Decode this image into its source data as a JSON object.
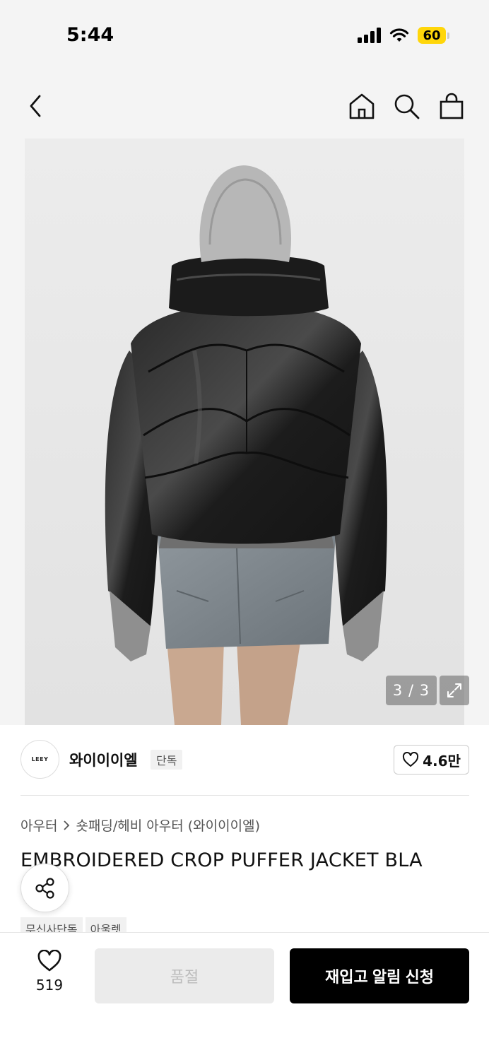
{
  "status_bar": {
    "time": "5:44",
    "battery": "60",
    "battery_color": "#ffd60a"
  },
  "nav": {
    "back_icon": "chevron-left-icon",
    "home_icon": "home-icon",
    "search_icon": "search-icon",
    "cart_icon": "shopping-bag-icon"
  },
  "gallery": {
    "counter": "3 / 3",
    "expand_icon": "expand-icon"
  },
  "brand": {
    "logo_text": "LEEY",
    "name": "와이이이엘",
    "badge": "단독",
    "likes": "4.6만"
  },
  "product": {
    "breadcrumb": [
      "아우터",
      "숏패딩/헤비 아우터 (와이이이엘)"
    ],
    "title": "EMBROIDERED CROP PUFFER JACKET BLA",
    "tags": [
      "무신사단독",
      "아울렛"
    ]
  },
  "bottom_bar": {
    "wish_count": "519",
    "soldout_label": "품절",
    "restock_label": "재입고 알림 신청"
  },
  "colors": {
    "accent": "#000000",
    "background": "#f4f4f4"
  }
}
